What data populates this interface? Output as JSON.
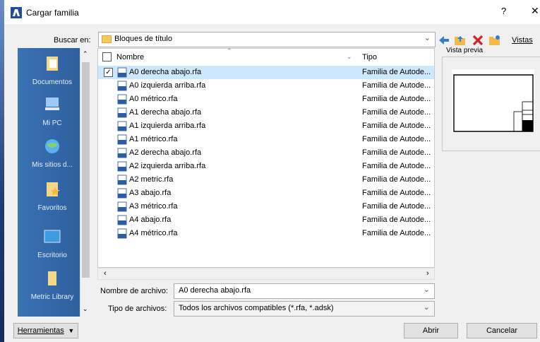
{
  "window": {
    "title": "Cargar familia",
    "help": "?",
    "close": "✕"
  },
  "lookin": {
    "label": "Buscar en:",
    "value": "Bloques de título"
  },
  "toolbar": {
    "views_label": "Vistas",
    "icons": [
      "back-arrow-icon",
      "up-folder-icon",
      "delete-icon",
      "new-folder-icon"
    ]
  },
  "places": [
    {
      "label": "Documentos",
      "icon": "documents-icon"
    },
    {
      "label": "Mi PC",
      "icon": "computer-icon"
    },
    {
      "label": "Mis sitios d...",
      "icon": "network-icon"
    },
    {
      "label": "Favoritos",
      "icon": "favorites-icon"
    },
    {
      "label": "Escritorio",
      "icon": "desktop-icon"
    },
    {
      "label": "Metric Library",
      "icon": "library-folder-icon"
    }
  ],
  "columns": {
    "name": "Nombre",
    "type": "Tipo"
  },
  "files": [
    {
      "name": "A0 derecha abajo.rfa",
      "type": "Familia de Autode...",
      "selected": true
    },
    {
      "name": "A0 izquierda arriba.rfa",
      "type": "Familia de Autode..."
    },
    {
      "name": "A0 métrico.rfa",
      "type": "Familia de Autode..."
    },
    {
      "name": "A1 derecha abajo.rfa",
      "type": "Familia de Autode..."
    },
    {
      "name": "A1 izquierda arriba.rfa",
      "type": "Familia de Autode..."
    },
    {
      "name": "A1 métrico.rfa",
      "type": "Familia de Autode..."
    },
    {
      "name": "A2 derecha abajo.rfa",
      "type": "Familia de Autode..."
    },
    {
      "name": "A2 izquierda arriba.rfa",
      "type": "Familia de Autode..."
    },
    {
      "name": "A2 metric.rfa",
      "type": "Familia de Autode..."
    },
    {
      "name": "A3 abajo.rfa",
      "type": "Familia de Autode..."
    },
    {
      "name": "A3 métrico.rfa",
      "type": "Familia de Autode..."
    },
    {
      "name": "A4 abajo.rfa",
      "type": "Familia de Autode..."
    },
    {
      "name": "A4 métrico.rfa",
      "type": "Familia de Autode..."
    }
  ],
  "preview": {
    "label": "Vista previa"
  },
  "filename": {
    "label": "Nombre de archivo:",
    "value": "A0 derecha abajo.rfa"
  },
  "filetype": {
    "label": "Tipo de archivos:",
    "value": "Todos los archivos compatibles  (*.rfa, *.adsk)"
  },
  "buttons": {
    "tools": "Herramientas",
    "open": "Abrir",
    "cancel": "Cancelar"
  }
}
